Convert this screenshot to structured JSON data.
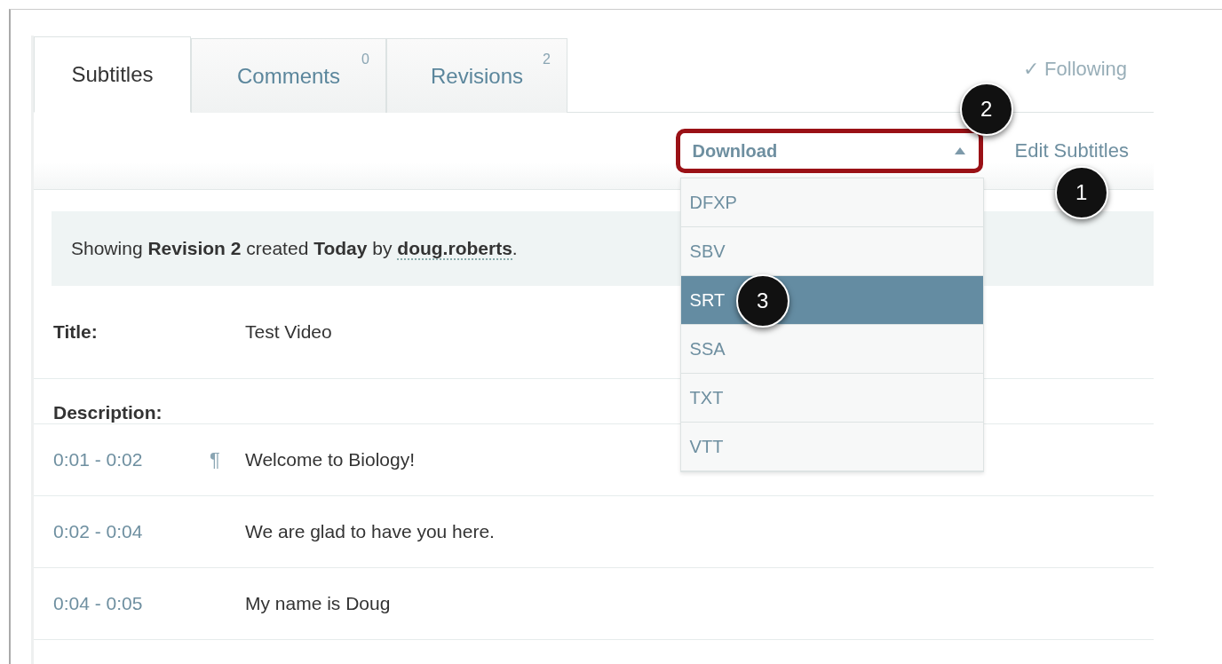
{
  "tabs": [
    {
      "label": "Subtitles",
      "selected": true
    },
    {
      "label": "Comments",
      "count": "0",
      "selected": false
    },
    {
      "label": "Revisions",
      "count": "2",
      "selected": false
    }
  ],
  "following": "✓ Following",
  "download": {
    "label": "Download",
    "expanded": true,
    "callout": "2",
    "options": [
      {
        "label": "DFXP",
        "selected": false
      },
      {
        "label": "SBV",
        "selected": false
      },
      {
        "label": "SRT",
        "selected": true,
        "callout": "3"
      },
      {
        "label": "SSA",
        "selected": false
      },
      {
        "label": "TXT",
        "selected": false
      },
      {
        "label": "VTT",
        "selected": false
      }
    ]
  },
  "edit_subtitles": {
    "label": "Edit Subtitles",
    "callout": "1"
  },
  "notice": {
    "text": "Showing **Revision 2** created **Today** by ",
    "user": "doug.roberts",
    "end": "."
  },
  "title": {
    "label": "Title:",
    "value": "Test Video"
  },
  "description": {
    "label": "Description:"
  },
  "lines": [
    {
      "time": "0:01 - 0:02",
      "mark": "¶",
      "text": "Welcome to Biology!"
    },
    {
      "time": "0:02 - 0:04",
      "text": "We are glad to have you here."
    },
    {
      "time": "0:04 - 0:05",
      "text": "My name is Doug"
    }
  ]
}
